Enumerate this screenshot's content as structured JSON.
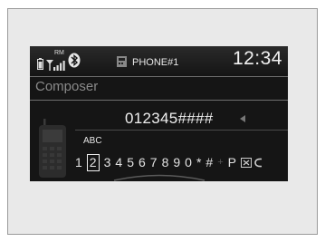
{
  "status": {
    "time": "12:34",
    "roaming": "RM",
    "phone_name": "PHONE#1"
  },
  "title": "Composer",
  "dialed_number": "012345####",
  "keypad": {
    "hint_above_selected": "ABC",
    "keys": [
      {
        "label": "1",
        "selected": false,
        "dim": false
      },
      {
        "label": "2",
        "selected": true,
        "dim": false
      },
      {
        "label": "3",
        "selected": false,
        "dim": false
      },
      {
        "label": "4",
        "selected": false,
        "dim": false
      },
      {
        "label": "5",
        "selected": false,
        "dim": false
      },
      {
        "label": "6",
        "selected": false,
        "dim": false
      },
      {
        "label": "7",
        "selected": false,
        "dim": false
      },
      {
        "label": "8",
        "selected": false,
        "dim": false
      },
      {
        "label": "9",
        "selected": false,
        "dim": false
      },
      {
        "label": "0",
        "selected": false,
        "dim": false
      },
      {
        "label": "*",
        "selected": false,
        "dim": false
      },
      {
        "label": "#",
        "selected": false,
        "dim": false
      },
      {
        "label": "+",
        "selected": false,
        "dim": true
      },
      {
        "label": "P",
        "selected": false,
        "dim": false
      }
    ]
  },
  "colors": {
    "screen_bg": "#151515",
    "text": "#f0f0f0",
    "muted_text": "#8a8a8a"
  }
}
